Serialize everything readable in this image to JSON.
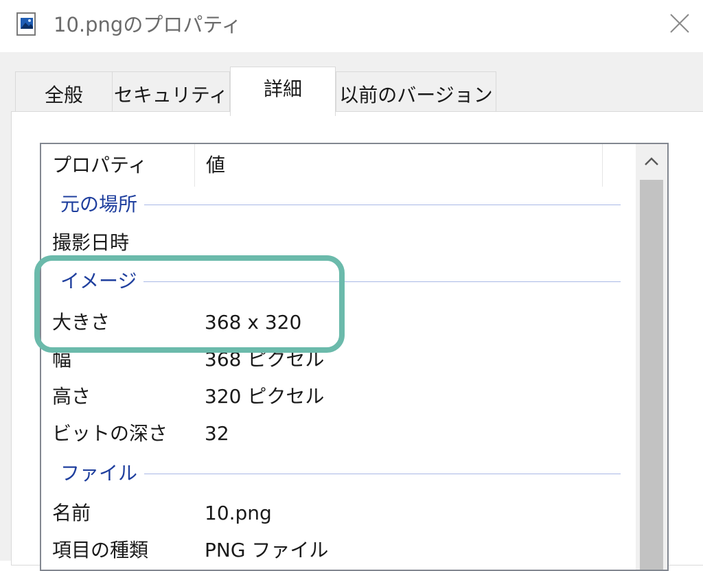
{
  "window": {
    "title": "10.pngのプロパティ",
    "icon": "image-file-icon",
    "close_icon": "close-icon"
  },
  "tabs": [
    {
      "label": "全般",
      "active": false
    },
    {
      "label": "セキュリティ",
      "active": false
    },
    {
      "label": "詳細",
      "active": true
    },
    {
      "label": "以前のバージョン",
      "active": false
    }
  ],
  "columns": {
    "property": "プロパティ",
    "value": "値"
  },
  "groups": {
    "origin": {
      "label": "元の場所",
      "rows": [
        {
          "key": "撮影日時",
          "value": ""
        }
      ]
    },
    "image": {
      "label": "イメージ",
      "rows": [
        {
          "key": "大きさ",
          "value": "368 x 320"
        },
        {
          "key": "幅",
          "value": "368 ピクセル"
        },
        {
          "key": "高さ",
          "value": "320 ピクセル"
        },
        {
          "key": "ビットの深さ",
          "value": "32"
        }
      ]
    },
    "file": {
      "label": "ファイル",
      "rows": [
        {
          "key": "名前",
          "value": "10.png"
        },
        {
          "key": "項目の種類",
          "value": "PNG ファイル"
        }
      ]
    }
  },
  "colors": {
    "group_label": "#1f3f9e",
    "highlight": "#6bbaab"
  }
}
